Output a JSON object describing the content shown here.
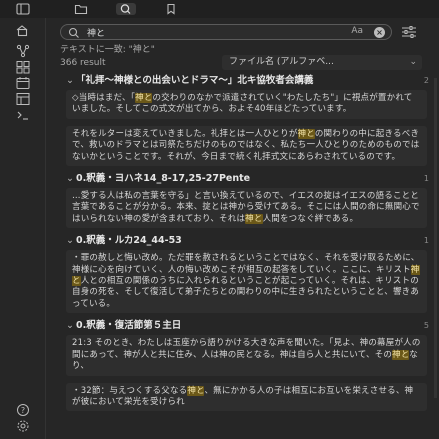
{
  "tabs": [
    "files",
    "search",
    "bookmarks"
  ],
  "ribbon_icons": [
    "open-quick-switcher-icon",
    "graph-view-icon",
    "canvas-icon",
    "daily-note-icon",
    "templates-icon",
    "command-palette-icon"
  ],
  "ribbon_bottom_icons": [
    "help-icon",
    "settings-icon"
  ],
  "search": {
    "query": "神と",
    "match_case_label": "Aa",
    "hint": "テキストに一致: \"神と\"",
    "result_count": "366 result",
    "sort_label": "ファイル名 (アルファベ..."
  },
  "results": [
    {
      "title": "「礼拝～神様との出会いとドラマ～」北キ協牧者会講義",
      "count": "2",
      "matches": [
        {
          "pre": "◇当時はまだ、「",
          "hit": "神と",
          "post": "の交わりのなかで派遣されていく\"わたしたち\"」に視点が置かれていました。そしてこの式文が出てから、およそ40年ほどたっています。"
        },
        {
          "pre": "それをルターは変えていきました。礼拝とは一人ひとりが",
          "hit": "神と",
          "post": "の関わりの中に起きるべきで、救いのドラマとは司祭たちだけのものではなく、私たち一人ひとりのためのものではないかということです。それが、今日まで続く礼拝式文にあらわされているのです。"
        }
      ]
    },
    {
      "title": "0.釈義・ヨハネ14_8-17,25-27Pente",
      "count": "1",
      "matches": [
        {
          "pre": "…愛する人は私の言葉を守る」と言い換えているので、イエスの掟はイエスの語ることと言葉であることが分かる。本来、掟とは神から受けてある。そこには人間の命に無関心ではいられない神の愛が含まれており、それは",
          "hit": "神と",
          "post": "人間をつなぐ絆である。"
        }
      ]
    },
    {
      "title": "0.釈義・ルカ24_44-53",
      "count": "1",
      "matches": [
        {
          "pre": "・罪の赦しと悔い改め。ただ罪を赦されるということではなく、それを受け取るために、神様に心を向けていく、人の悔い改めこそが相互の起答をしていく。ここに、キリスト",
          "hit": "神と",
          "post": "人との相互の関係のうちに入れられるということが起こっていく。それは、キリストの自身の死を、そして復活して弟子たちとの関わりの中に生きられたということと、響きあっている。"
        }
      ]
    },
    {
      "title": "0.釈義・復活節第５主日",
      "count": "5",
      "matches": [
        {
          "pre": "21:3 そのとき、わたしは玉座から語りかける大きな声を聞いた。「見よ、神の幕屋が人の間にあって、神が人と共に住み、人は神の民となる。神は自ら人と共にいて、その",
          "hit": "神と",
          "post": "なり、"
        },
        {
          "pre": "・32節：与えつくする父なる",
          "hit": "神と",
          "post": "、無にかかる人の子は相互にお互いを栄えさせる、神が彼において栄光を受けられ"
        }
      ]
    }
  ],
  "colors": {
    "background": "#1e1e1e",
    "panel": "#262626",
    "highlight_bg": "#6b5818",
    "highlight_text": "#f1e2a6"
  }
}
